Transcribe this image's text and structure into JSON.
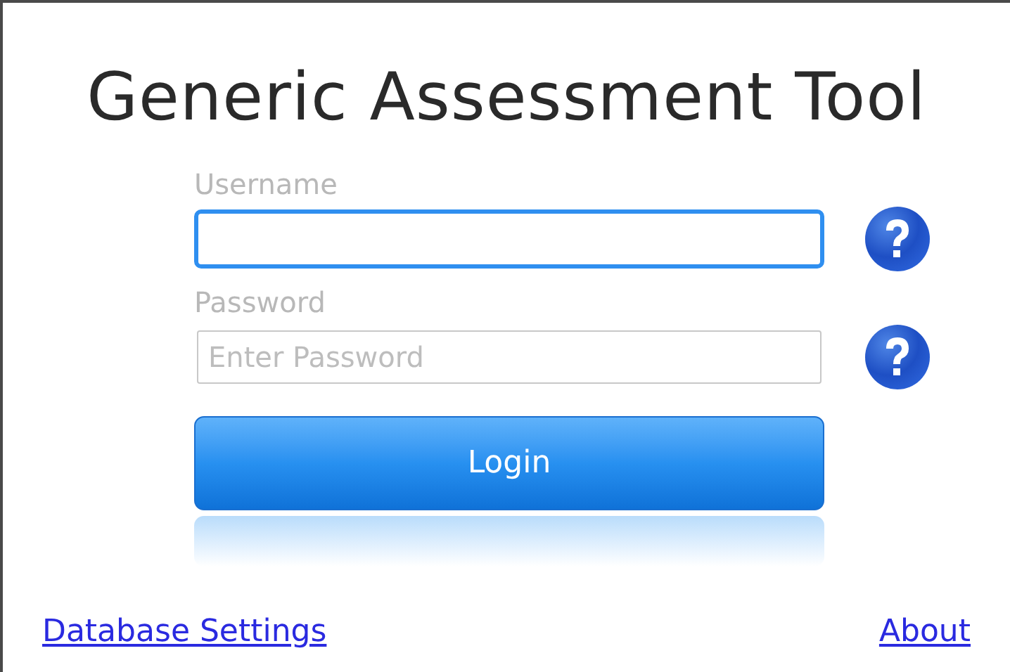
{
  "title": "Generic Assessment Tool",
  "fields": [
    {
      "label": "Username",
      "focused": true
    },
    {
      "label": "Password",
      "placeholder": "Enter Password",
      "focused": false
    }
  ],
  "login_button": "Login",
  "links": [
    "Database Settings",
    "About"
  ]
}
